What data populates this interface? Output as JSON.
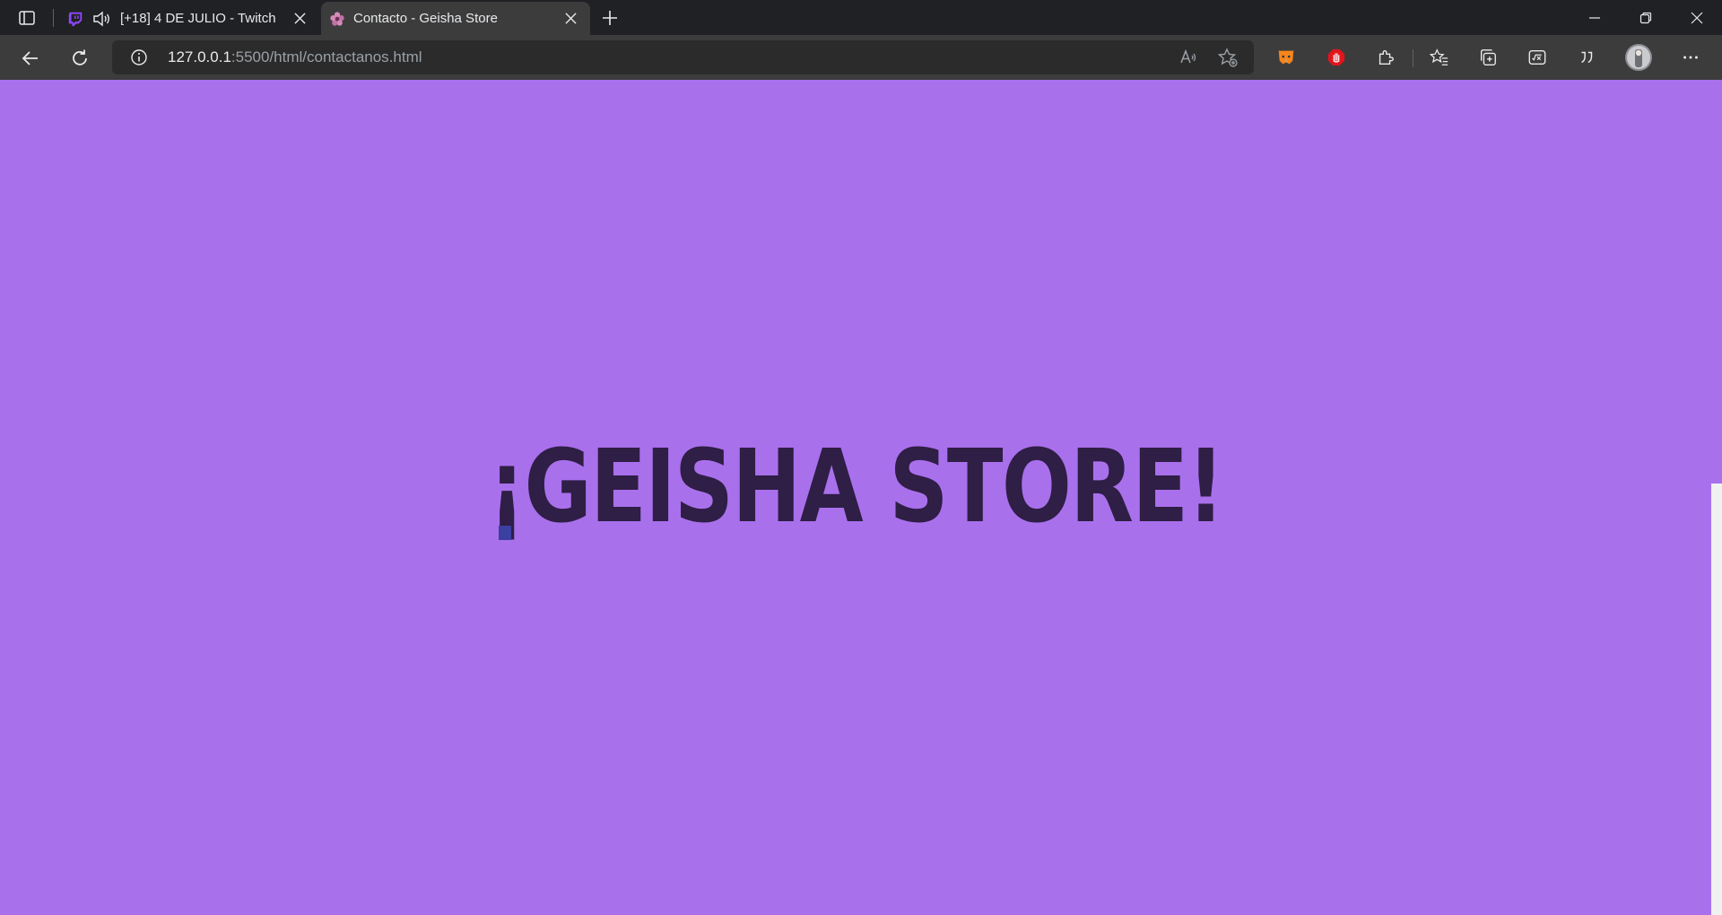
{
  "browser": {
    "tabs": [
      {
        "title": "[+18] 4 DE JULIO - Twitch",
        "favicon": "twitch-icon",
        "audio": true,
        "active": false
      },
      {
        "title": "Contacto - Geisha Store",
        "favicon": "geisha-flower-icon",
        "active": true
      }
    ],
    "url": {
      "host": "127.0.0.1",
      "rest": ":5500/html/contactanos.html"
    },
    "toolbar_icons": [
      "read-aloud-icon",
      "add-favorite-icon",
      "metamask-icon",
      "adblock-icon",
      "extensions-icon",
      "favorites-icon",
      "collections-icon",
      "math-solver-icon",
      "quote-icon",
      "profile-avatar",
      "more-menu-icon"
    ]
  },
  "page": {
    "hero_title": "¡GEISHA STORE!",
    "background_color": "#a970ec",
    "text_color": "#2f1e45"
  }
}
